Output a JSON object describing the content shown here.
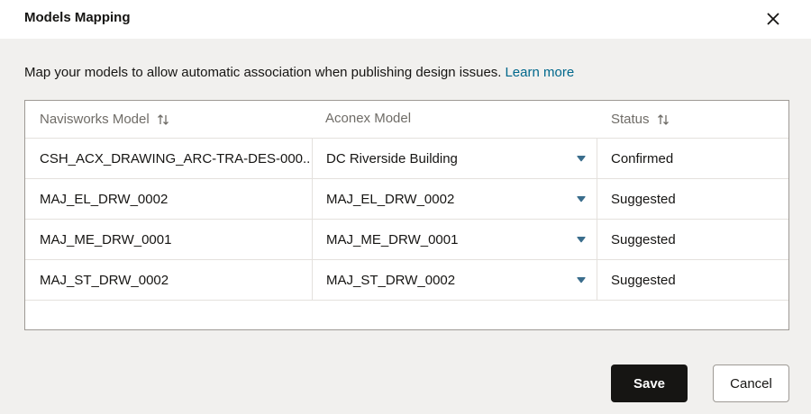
{
  "dialog": {
    "title": "Models Mapping",
    "close_icon": "close-icon"
  },
  "intro": {
    "text": "Map your models to allow automatic association when publishing design issues.",
    "link": "Learn more"
  },
  "table": {
    "columns": {
      "navisworks": "Navisworks Model",
      "aconex": "Aconex Model",
      "status": "Status"
    },
    "rows": [
      {
        "navisworks": "CSH_ACX_DRAWING_ARC-TRA-DES-000...",
        "aconex": "DC Riverside Building",
        "status": "Confirmed"
      },
      {
        "navisworks": "MAJ_EL_DRW_0002",
        "aconex": "MAJ_EL_DRW_0002",
        "status": "Suggested"
      },
      {
        "navisworks": "MAJ_ME_DRW_0001",
        "aconex": "MAJ_ME_DRW_0001",
        "status": "Suggested"
      },
      {
        "navisworks": "MAJ_ST_DRW_0002",
        "aconex": "MAJ_ST_DRW_0002",
        "status": "Suggested"
      }
    ]
  },
  "footer": {
    "save_label": "Save",
    "cancel_label": "Cancel"
  },
  "colors": {
    "link": "#00688c",
    "primary_button": "#161513",
    "caret": "#3a6d8c"
  }
}
